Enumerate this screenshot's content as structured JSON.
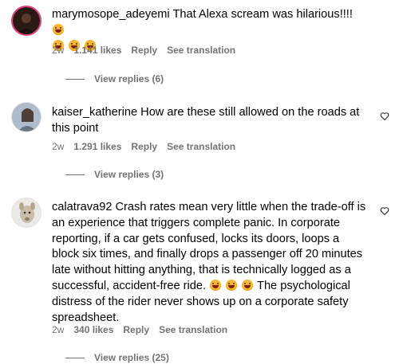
{
  "comments": [
    {
      "username": "marymosope_adeyemi",
      "text": "That Alexa scream was hilarious!!!!",
      "time": "2w",
      "likes": "1.141 likes",
      "reply": "Reply",
      "translate": "See translation",
      "view_replies": "View replies (6)"
    },
    {
      "username": "kaiser_katherine",
      "text": "How are these still allowed on the roads at this point",
      "time": "2w",
      "likes": "1.291 likes",
      "reply": "Reply",
      "translate": "See translation",
      "view_replies": "View replies (3)"
    },
    {
      "username": "calatrava92",
      "text_part1": "Crash rates mean very little when the trade-off is an experience that triggers complete panic. In corporate reporting, if a car gets confused, locks its doors, loops a block six times, and finally drops a passenger off 20 minutes late without hitting anything, that is technically logged as a successful, accident-free ride.",
      "text_part2": "The psychological distress of the rider never shows up on a corporate safety spreadsheet.",
      "time": "2w",
      "likes": "340 likes",
      "reply": "Reply",
      "translate": "See translation",
      "view_replies": "View replies (25)"
    }
  ]
}
